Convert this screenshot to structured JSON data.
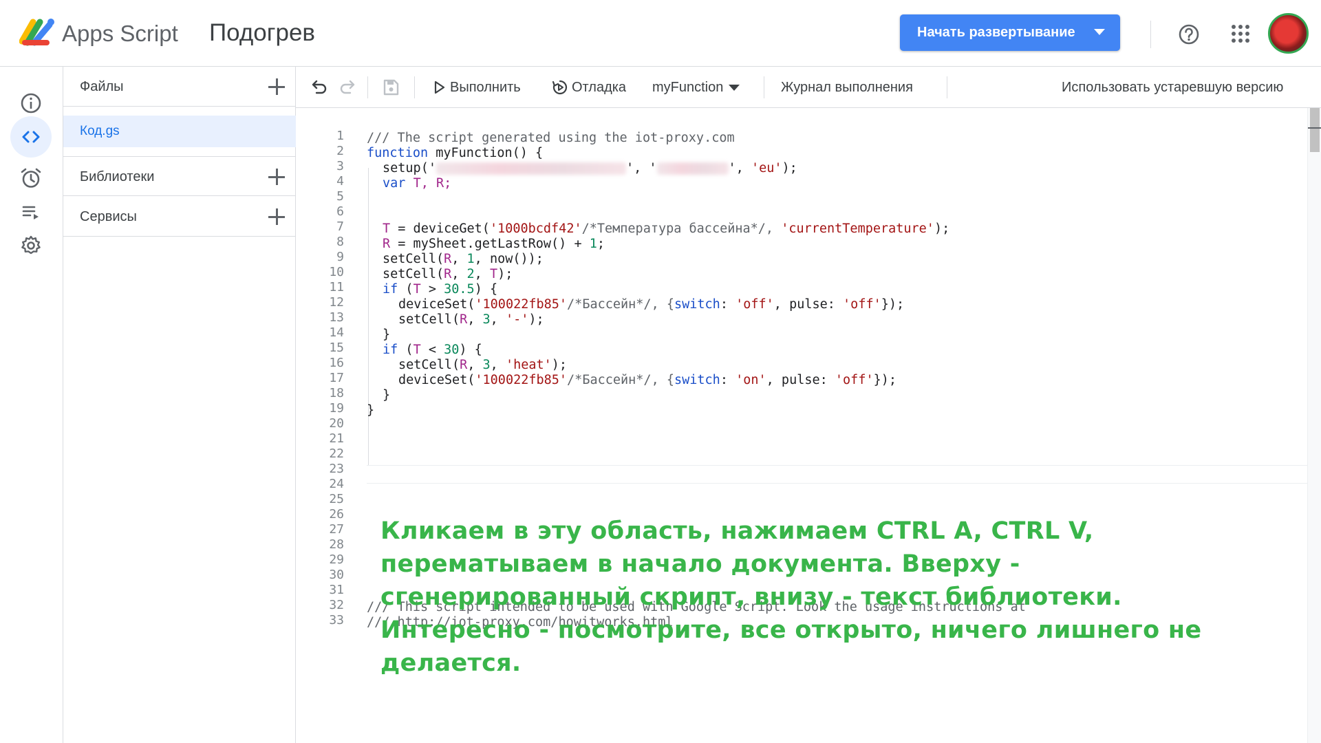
{
  "header": {
    "app_name": "Apps Script",
    "project_title": "Подогрев",
    "deploy_label": "Начать развертывание",
    "accent_color": "#4285f4"
  },
  "rail": {
    "items": [
      {
        "icon": "info-icon",
        "label": "Overview"
      },
      {
        "icon": "code-icon",
        "label": "Editor",
        "active": true
      },
      {
        "icon": "alarm-clock-icon",
        "label": "Triggers"
      },
      {
        "icon": "executions-list-icon",
        "label": "Executions"
      },
      {
        "icon": "gear-icon",
        "label": "Settings"
      }
    ]
  },
  "files_panel": {
    "files_label": "Файлы",
    "file_name": "Код.gs",
    "libraries_label": "Библиотеки",
    "services_label": "Сервисы"
  },
  "toolbar": {
    "run_label": "Выполнить",
    "debug_label": "Отладка",
    "function_name": "myFunction",
    "log_label": "Журнал выполнения",
    "legacy_label": "Использовать устаревшую версию"
  },
  "editor": {
    "line_numbers": [
      "1",
      "2",
      "3",
      "4",
      "5",
      "6",
      "7",
      "8",
      "9",
      "10",
      "11",
      "12",
      "13",
      "14",
      "15",
      "16",
      "17",
      "18",
      "19",
      "20",
      "21",
      "22",
      "23",
      "24",
      "25",
      "26",
      "27",
      "28",
      "29",
      "30",
      "31",
      "32",
      "33"
    ],
    "lines": {
      "l1": "/// The script generated using the iot-proxy.com",
      "l2_kw": "function",
      "l2_rest": " myFunction() {",
      "l3_a": "setup('",
      "l3_b": "', '",
      "l3_c": "', ",
      "l3_eu": "'eu'",
      "l3_end": ");",
      "l4_kw": "var",
      "l4_rest": "T, R;",
      "l7_a": "= deviceGet(",
      "l7_s1": "'1000bcdf42'",
      "l7_c": "/*Температура бассейна*/, ",
      "l7_s2": "'currentTemperature'",
      "l7_end": ");",
      "l8": "= mySheet.getLastRow() + ",
      "l8_num": "1",
      "l8_end": ";",
      "l9_a": "setCell(",
      "l9_b": ", ",
      "l9_num": "1",
      "l9_end": ", now());",
      "l10_a": "setCell(",
      "l10_num": "2",
      "l10_end": ");",
      "l11_kw": "if",
      "l11_a": " (",
      "l11_b": " > ",
      "l11_num": "30.5",
      "l11_end": ") {",
      "l12_a": "deviceSet(",
      "l12_s1": "'100022fb85'",
      "l12_c": "/*Бассейн*/, {",
      "l12_prop": "switch",
      "l12_d": ": ",
      "l12_off": "'off'",
      "l12_e": ", pulse: ",
      "l12_end": "});",
      "l13_a": "setCell(",
      "l13_num": "3",
      "l13_s": "'-'",
      "l13_end": ");",
      "l14": "}",
      "l15_b": " < ",
      "l15_num": "30",
      "l16_s": "'heat'",
      "l17_on": "'on'",
      "l18": "}",
      "l19": "}",
      "l32": "/// This script intended to be used with Google Script. Look the usage instructions at",
      "l33": "/// http://iot-proxy.com/howitworks.html"
    },
    "annotation": "Кликаем в эту область, нажимаем CTRL A, CTRL V, перематываем в начало документа. Вверху - сгенерированный скрипт, внизу - текст библиотеки. Интересно - посмотрите, все открыто, ничего лишнего не делается.",
    "annotation_color": "#39b54a"
  }
}
